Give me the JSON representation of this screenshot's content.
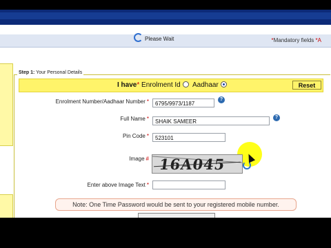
{
  "header": {
    "mandatory_marker": "*",
    "mandatory_text": "Mandatory fields",
    "mandatory_extra": "*A"
  },
  "status": {
    "please_wait": "Please Wait"
  },
  "panel": {
    "step_label": "Step 1:",
    "step_title": " Your Personal Details"
  },
  "have_bar": {
    "prefix": "I have",
    "star": "*",
    "option1": "Enrolment Id",
    "option2": "Aadhaar",
    "selected": "Aadhaar",
    "reset_label": "Reset"
  },
  "form": {
    "enrolment_label": "Enrolment Number/Aadhaar Number",
    "enrolment_value": "6795/9973/1187",
    "fullname_label": "Full Name",
    "fullname_value": "SHAIK SAMEER",
    "pincode_label": "Pin Code",
    "pincode_value": "523101",
    "image_label": "Image",
    "image_hash": "#",
    "captcha_text": "16A045",
    "captcha_input_label": "Enter above Image Text",
    "captcha_input_value": "",
    "required_marker": "*"
  },
  "note": {
    "text": "Note: One Time Password would be sent to your registered mobile number."
  },
  "colors": {
    "accent_yellow": "#fff46a",
    "header_blue": "#0c2a78",
    "required_red": "#cc0000"
  }
}
